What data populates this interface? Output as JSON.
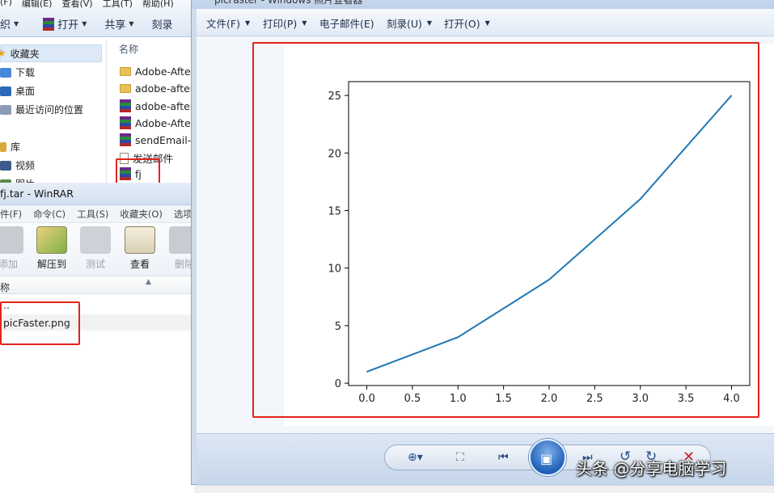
{
  "explorer": {
    "menu": [
      "(F)",
      "编辑(E)",
      "查看(V)",
      "工具(T)",
      "帮助(H)"
    ],
    "commands": {
      "organize": "织",
      "open": "打开",
      "share": "共享",
      "burn": "刻录"
    },
    "nav": {
      "favorites": "收藏夹",
      "downloads": "下载",
      "desktop": "桌面",
      "recent": "最近访问的位置",
      "libraries": "库",
      "videos": "视频",
      "pictures": "图片"
    },
    "files": {
      "column_name": "名称",
      "items": [
        {
          "name": "Adobe-Afte",
          "icon": "folder-icon"
        },
        {
          "name": "adobe-after",
          "icon": "folder-icon"
        },
        {
          "name": "adobe-after",
          "icon": "winrar-archive-icon"
        },
        {
          "name": "Adobe-Afte",
          "icon": "winrar-archive-icon"
        },
        {
          "name": "sendEmail-v",
          "icon": "winrar-archive-icon"
        },
        {
          "name": "发送邮件",
          "icon": "document-icon"
        },
        {
          "name": "fj",
          "icon": "winrar-archive-icon"
        }
      ]
    }
  },
  "winrar": {
    "title": "fj.tar - WinRAR",
    "menu": [
      "件(F)",
      "命令(C)",
      "工具(S)",
      "收藏夹(O)",
      "选项"
    ],
    "tools": {
      "add": "添加",
      "extract": "解压到",
      "test": "测试",
      "view": "查看",
      "delete": "删除"
    },
    "column_name": "称",
    "rows": [
      "..",
      "picFaster.png"
    ]
  },
  "viewer": {
    "title": "picFaster - Windows 照片查看器",
    "menu": {
      "file": "文件(F)",
      "print": "打印(P)",
      "email": "电子邮件(E)",
      "burn": "刻录(U)",
      "open": "打开(O)"
    }
  },
  "chart_data": {
    "type": "line",
    "x": [
      0.0,
      1.0,
      2.0,
      3.0,
      4.0
    ],
    "series": [
      {
        "values": [
          1,
          4,
          9,
          16,
          25
        ],
        "color": "#1f77b4"
      }
    ],
    "xticks": [
      "0.0",
      "0.5",
      "1.0",
      "1.5",
      "2.0",
      "2.5",
      "3.0",
      "3.5",
      "4.0"
    ],
    "yticks": [
      "0",
      "5",
      "10",
      "15",
      "20",
      "25"
    ],
    "xlim": [
      -0.2,
      4.2
    ],
    "ylim": [
      -0.2,
      26.2
    ],
    "grid": false,
    "title": "",
    "xlabel": "",
    "ylabel": ""
  },
  "watermark": "头条 @分享电脑学习",
  "colors": {
    "highlight_box": "#e2231a",
    "line": "#1f77b4"
  }
}
